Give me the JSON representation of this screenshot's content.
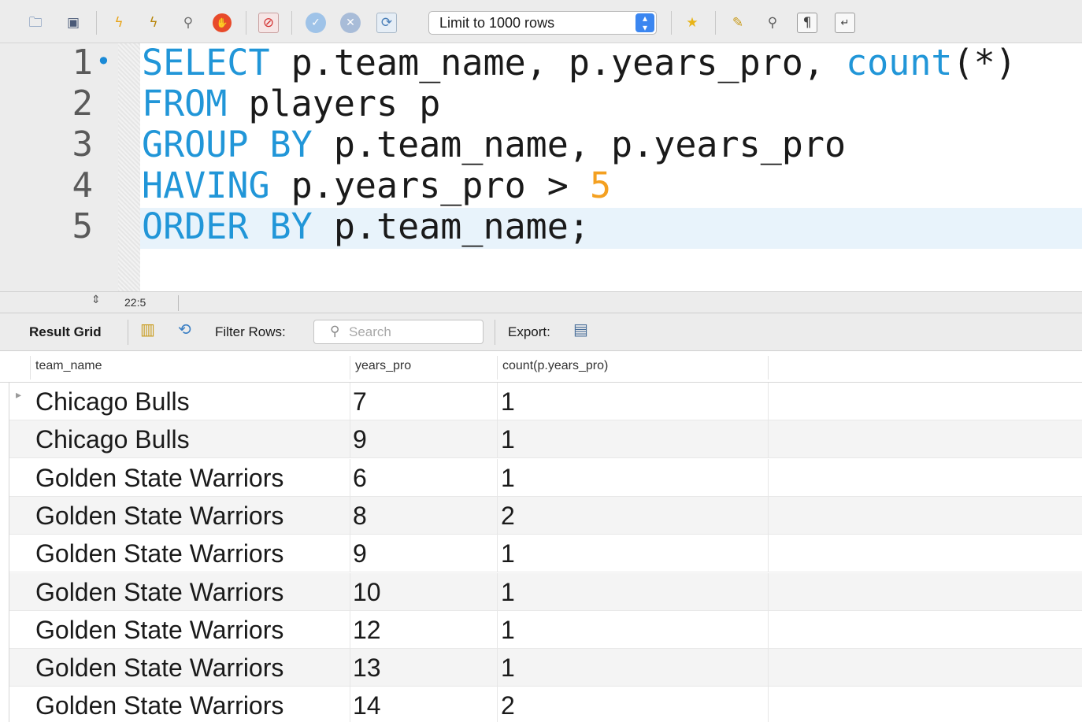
{
  "toolbar": {
    "icons": [
      "folder-icon",
      "save-icon",
      "execute-icon",
      "execute-current-icon",
      "explain-icon",
      "stop-icon",
      "toggle-error-icon",
      "commit-icon",
      "rollback-icon",
      "autocommit-icon",
      "bookmark-icon",
      "beautify-icon",
      "find-icon",
      "invisibles-icon",
      "wrap-icon"
    ],
    "limit_label": "Limit to 1000 rows"
  },
  "editor": {
    "lines": [
      {
        "num": "1"
      },
      {
        "num": "2"
      },
      {
        "num": "3"
      },
      {
        "num": "4"
      },
      {
        "num": "5"
      }
    ],
    "tokens": {
      "l1_kw": "SELECT",
      "l1_mid": " p.team_name, p.years_pro, ",
      "l1_fn": "count",
      "l1_end": "(*)",
      "l2_kw": "FROM",
      "l2_end": " players p",
      "l3_kw": "GROUP BY",
      "l3_end": " p.team_name, p.years_pro",
      "l4_kw": "HAVING",
      "l4_mid": " p.years_pro > ",
      "l4_num": "5",
      "l5_kw": "ORDER BY",
      "l5_end": " p.team_name;"
    },
    "fold_marker": "•"
  },
  "status": {
    "cursor_position": "22:5"
  },
  "result_bar": {
    "result_grid_label": "Result Grid",
    "filter_rows_label": "Filter Rows:",
    "search_placeholder": "Search",
    "export_label": "Export:"
  },
  "grid": {
    "columns": [
      "team_name",
      "years_pro",
      "count(p.years_pro)"
    ],
    "rows": [
      [
        "Chicago Bulls",
        "7",
        "1"
      ],
      [
        "Chicago Bulls",
        "9",
        "1"
      ],
      [
        "Golden State Warriors",
        "6",
        "1"
      ],
      [
        "Golden State Warriors",
        "8",
        "2"
      ],
      [
        "Golden State Warriors",
        "9",
        "1"
      ],
      [
        "Golden State Warriors",
        "10",
        "1"
      ],
      [
        "Golden State Warriors",
        "12",
        "1"
      ],
      [
        "Golden State Warriors",
        "13",
        "1"
      ],
      [
        "Golden State Warriors",
        "14",
        "2"
      ]
    ]
  }
}
